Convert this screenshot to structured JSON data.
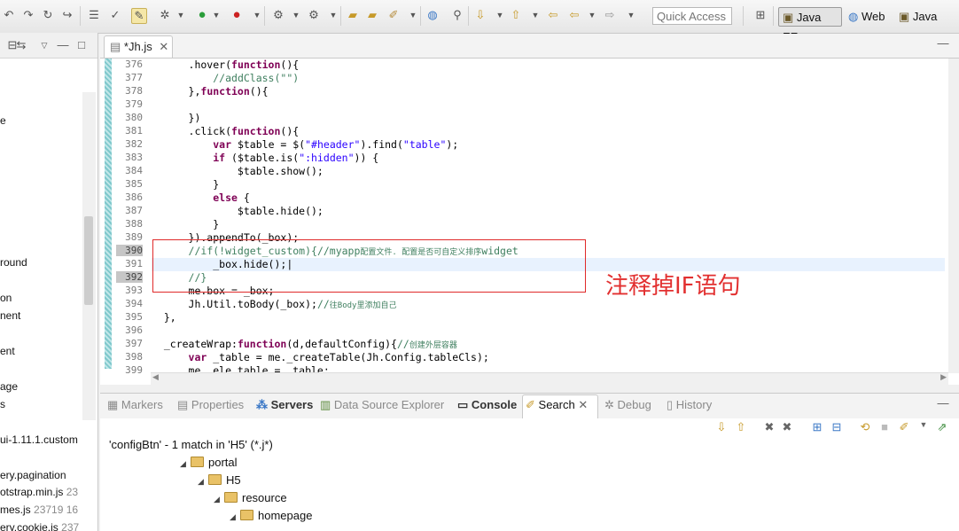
{
  "toolbar": {
    "quick_access_placeholder": "Quick Access"
  },
  "perspectives": [
    {
      "label": "Java EE"
    },
    {
      "label": "Web"
    },
    {
      "label": "Java"
    }
  ],
  "left_panel": {
    "items": [
      {
        "text": "e"
      },
      {
        "text": "round"
      },
      {
        "text": "on"
      },
      {
        "text": "nent"
      },
      {
        "text": "ent"
      },
      {
        "text": "age"
      },
      {
        "text": "s"
      },
      {
        "text": "ui-1.11.1.custom"
      },
      {
        "text": "ery.pagination"
      },
      {
        "text": "otstrap.min.js",
        "num": "23"
      },
      {
        "text": "mes.js",
        "num": "23719  16"
      },
      {
        "text": "ery.cookie.js",
        "num": "237"
      }
    ]
  },
  "editor": {
    "tab_label": "*Jh.js",
    "line_numbers": [
      "376",
      "377",
      "378",
      "379",
      "380",
      "381",
      "382",
      "383",
      "384",
      "385",
      "386",
      "387",
      "388",
      "389",
      "390",
      "391",
      "392",
      "393",
      "394",
      "395",
      "396",
      "397",
      "398",
      "399"
    ],
    "annotation": "注释掉IF语句"
  },
  "bottom": {
    "tabs": [
      {
        "label": "Markers"
      },
      {
        "label": "Properties"
      },
      {
        "label": "Servers"
      },
      {
        "label": "Data Source Explorer"
      },
      {
        "label": "Console"
      },
      {
        "label": "Search"
      },
      {
        "label": "Debug"
      },
      {
        "label": "History"
      }
    ],
    "search_result": "'configBtn' - 1 match in 'H5' (*.j*)",
    "tree": [
      {
        "label": "portal"
      },
      {
        "label": "H5"
      },
      {
        "label": "resource"
      },
      {
        "label": "homepage"
      }
    ]
  }
}
